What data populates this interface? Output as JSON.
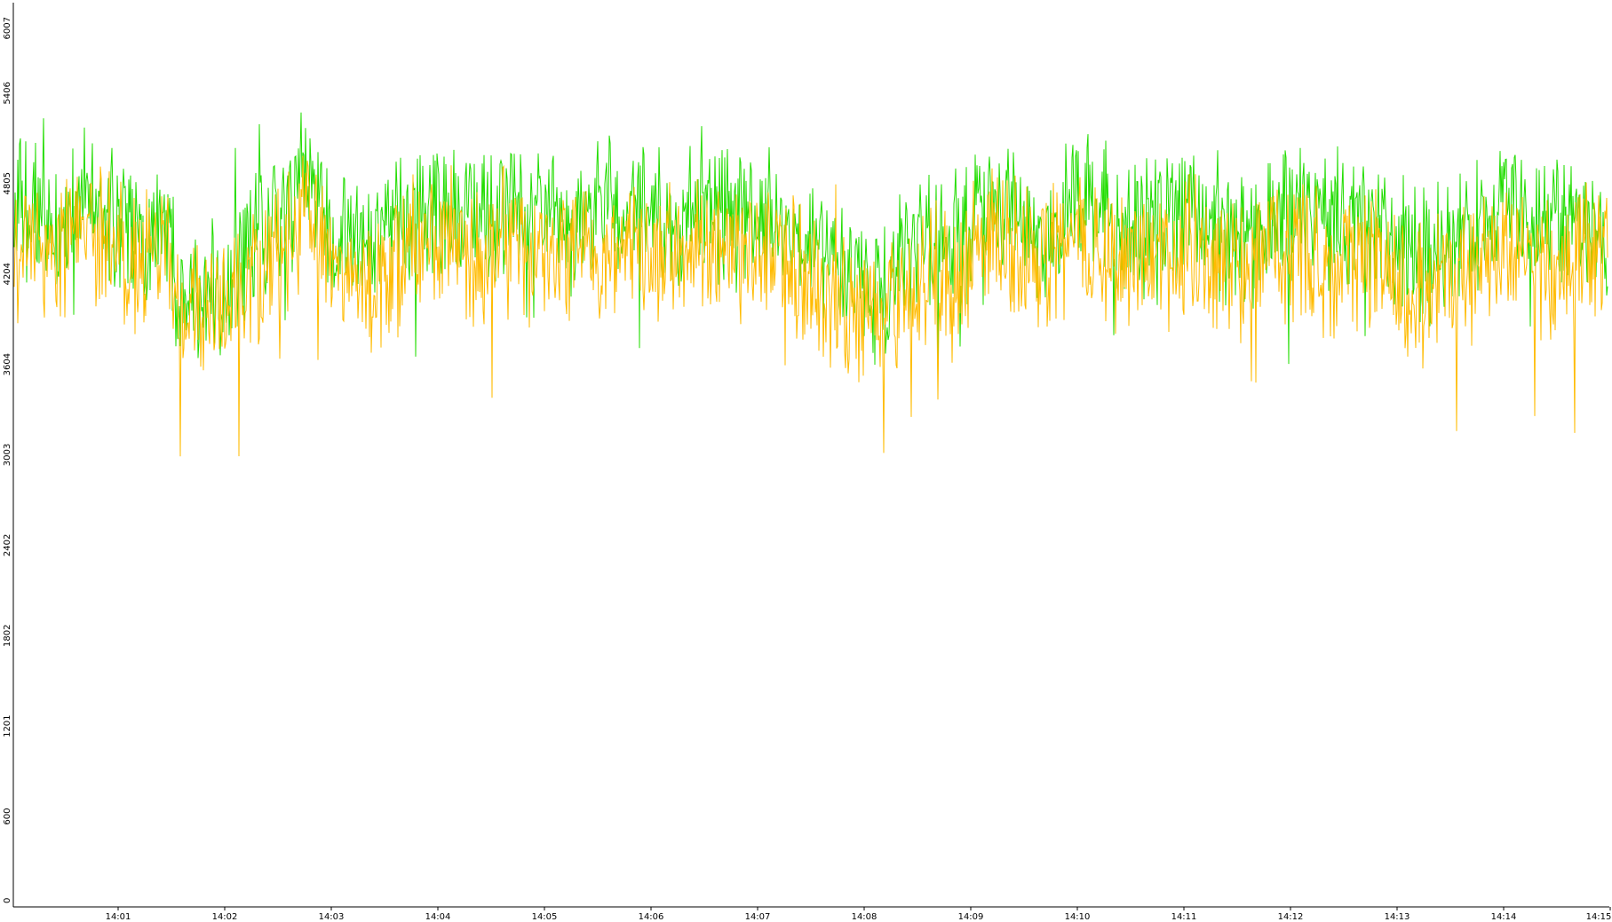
{
  "chart_data": {
    "type": "line",
    "title": "",
    "xlabel": "",
    "ylabel": "",
    "ylim": [
      0,
      6007
    ],
    "y_ticks": [
      "0",
      "600",
      "1201",
      "1802",
      "2402",
      "3003",
      "3604",
      "4204",
      "4805",
      "5406",
      "6007"
    ],
    "x_ticks": [
      "14:01",
      "14:02",
      "14:03",
      "14:04",
      "14:05",
      "14:06",
      "14:07",
      "14:08",
      "14:09",
      "14:10",
      "14:11",
      "14:12",
      "14:13",
      "14:14",
      "14:15"
    ],
    "x_range_minutes": [
      14.005,
      15.0
    ],
    "grid": false,
    "legend": "none",
    "series": [
      {
        "color": "#22dd00",
        "keypoints": [
          [
            14.005,
            4600
          ],
          [
            14.05,
            4550
          ],
          [
            14.1,
            4450
          ],
          [
            14.15,
            4700
          ],
          [
            14.2,
            4600
          ],
          [
            14.25,
            4550
          ],
          [
            14.3,
            4450
          ],
          [
            14.35,
            4600
          ],
          [
            14.4,
            4200
          ],
          [
            14.45,
            4150
          ],
          [
            14.5,
            4100
          ],
          [
            14.55,
            4300
          ],
          [
            14.6,
            4400
          ],
          [
            14.65,
            4450
          ],
          [
            14.7,
            4700
          ],
          [
            14.73,
            5050
          ],
          [
            14.75,
            4750
          ],
          [
            14.8,
            4500
          ],
          [
            14.85,
            4400
          ],
          [
            14.9,
            4350
          ],
          [
            14.95,
            4450
          ],
          [
            15.0,
            4550
          ],
          [
            15.05,
            4700
          ],
          [
            15.1,
            4650
          ],
          [
            15.15,
            4600
          ],
          [
            15.2,
            4550
          ],
          [
            15.25,
            4650
          ],
          [
            15.3,
            4600
          ],
          [
            15.35,
            4550
          ],
          [
            15.4,
            4500
          ],
          [
            15.45,
            4600
          ],
          [
            15.5,
            4650
          ],
          [
            15.55,
            4600
          ],
          [
            15.6,
            4650
          ],
          [
            15.65,
            4600
          ],
          [
            15.7,
            4550
          ],
          [
            15.75,
            4700
          ],
          [
            15.8,
            4600
          ],
          [
            15.85,
            4500
          ],
          [
            15.9,
            4550
          ],
          [
            15.95,
            4600
          ],
          [
            16.0,
            4500
          ],
          [
            16.05,
            4450
          ],
          [
            16.1,
            4350
          ],
          [
            16.15,
            4200
          ],
          [
            16.2,
            4100
          ],
          [
            16.25,
            4050
          ],
          [
            16.3,
            4300
          ],
          [
            16.35,
            4400
          ],
          [
            16.4,
            4500
          ],
          [
            16.45,
            4450
          ],
          [
            16.5,
            4650
          ],
          [
            16.55,
            4700
          ],
          [
            16.6,
            4600
          ],
          [
            16.65,
            4500
          ],
          [
            16.7,
            4550
          ],
          [
            16.75,
            4700
          ],
          [
            16.8,
            4650
          ],
          [
            16.85,
            4550
          ],
          [
            16.9,
            4500
          ],
          [
            16.95,
            4550
          ],
          [
            17.0,
            4600
          ],
          [
            17.05,
            4700
          ],
          [
            17.1,
            4600
          ],
          [
            17.15,
            4450
          ],
          [
            17.2,
            4500
          ],
          [
            17.25,
            4600
          ],
          [
            17.3,
            4650
          ],
          [
            17.35,
            4600
          ],
          [
            17.4,
            4550
          ],
          [
            17.45,
            4500
          ],
          [
            17.5,
            4600
          ],
          [
            17.55,
            4500
          ],
          [
            17.6,
            4400
          ],
          [
            17.65,
            4300
          ],
          [
            17.7,
            4350
          ],
          [
            17.75,
            4400
          ],
          [
            17.8,
            4500
          ],
          [
            17.85,
            4600
          ],
          [
            17.9,
            4700
          ],
          [
            17.95,
            4550
          ],
          [
            18.0,
            4500
          ],
          [
            18.05,
            4550
          ],
          [
            18.1,
            4600
          ],
          [
            18.15,
            4500
          ]
        ]
      },
      {
        "color": "#ffbb00",
        "keypoints": [
          [
            14.005,
            4400
          ],
          [
            14.05,
            4350
          ],
          [
            14.1,
            4300
          ],
          [
            14.15,
            4500
          ],
          [
            14.2,
            4450
          ],
          [
            14.25,
            4350
          ],
          [
            14.3,
            4250
          ],
          [
            14.35,
            4400
          ],
          [
            14.4,
            4000
          ],
          [
            14.45,
            3950
          ],
          [
            14.5,
            3900
          ],
          [
            14.55,
            4100
          ],
          [
            14.6,
            4200
          ],
          [
            14.65,
            4250
          ],
          [
            14.7,
            4450
          ],
          [
            14.73,
            4750
          ],
          [
            14.75,
            4550
          ],
          [
            14.8,
            4300
          ],
          [
            14.85,
            4200
          ],
          [
            14.9,
            4150
          ],
          [
            14.95,
            4250
          ],
          [
            15.0,
            4350
          ],
          [
            15.05,
            4450
          ],
          [
            15.1,
            4450
          ],
          [
            15.15,
            4350
          ],
          [
            15.2,
            4300
          ],
          [
            15.25,
            4400
          ],
          [
            15.3,
            4400
          ],
          [
            15.35,
            4300
          ],
          [
            15.4,
            4250
          ],
          [
            15.45,
            4350
          ],
          [
            15.5,
            4400
          ],
          [
            15.55,
            4350
          ],
          [
            15.6,
            4400
          ],
          [
            15.65,
            4350
          ],
          [
            15.7,
            4300
          ],
          [
            15.75,
            4450
          ],
          [
            15.8,
            4350
          ],
          [
            15.85,
            4250
          ],
          [
            15.9,
            4300
          ],
          [
            15.95,
            4350
          ],
          [
            16.0,
            4250
          ],
          [
            16.05,
            4200
          ],
          [
            16.1,
            4100
          ],
          [
            16.15,
            4000
          ],
          [
            16.2,
            3900
          ],
          [
            16.25,
            3850
          ],
          [
            16.3,
            4050
          ],
          [
            16.35,
            4150
          ],
          [
            16.4,
            4250
          ],
          [
            16.45,
            4200
          ],
          [
            16.5,
            4400
          ],
          [
            16.55,
            4450
          ],
          [
            16.6,
            4350
          ],
          [
            16.65,
            4250
          ],
          [
            16.7,
            4300
          ],
          [
            16.75,
            4450
          ],
          [
            16.8,
            4400
          ],
          [
            16.85,
            4300
          ],
          [
            16.9,
            4250
          ],
          [
            16.95,
            4300
          ],
          [
            17.0,
            4350
          ],
          [
            17.05,
            4450
          ],
          [
            17.1,
            4350
          ],
          [
            17.15,
            4200
          ],
          [
            17.2,
            4250
          ],
          [
            17.25,
            4350
          ],
          [
            17.3,
            4400
          ],
          [
            17.35,
            4350
          ],
          [
            17.4,
            4300
          ],
          [
            17.45,
            4250
          ],
          [
            17.5,
            4350
          ],
          [
            17.55,
            4250
          ],
          [
            17.6,
            4150
          ],
          [
            17.65,
            4050
          ],
          [
            17.7,
            4100
          ],
          [
            17.75,
            4150
          ],
          [
            17.8,
            4250
          ],
          [
            17.85,
            4350
          ],
          [
            17.9,
            4450
          ],
          [
            17.95,
            4300
          ],
          [
            18.0,
            4250
          ],
          [
            18.05,
            4300
          ],
          [
            18.1,
            4350
          ],
          [
            18.15,
            4250
          ]
        ]
      }
    ]
  }
}
